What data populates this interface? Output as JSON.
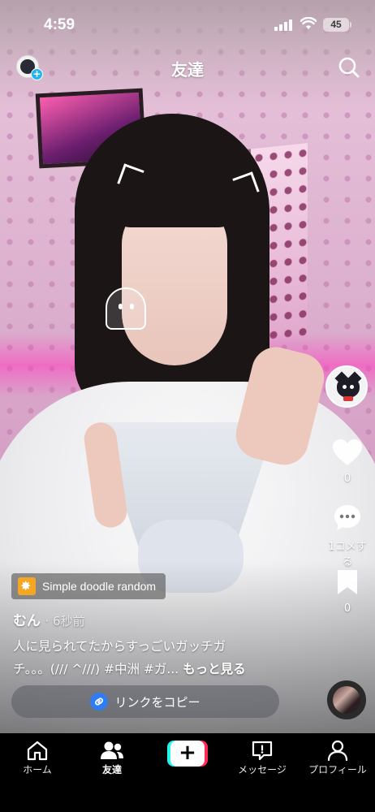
{
  "status_bar": {
    "time": "4:59",
    "battery": "45"
  },
  "header": {
    "title": "友達"
  },
  "rail": {
    "like_count": "0",
    "comment_label": "1コメする",
    "bookmark_count": "0"
  },
  "video": {
    "effect_label": "Simple doodle random",
    "author": "むん",
    "posted": "· 6秒前",
    "caption_line1": "人に見られてたからすっごいガッチガ",
    "caption_line2": "チ。。。(/// ^///) #中洲 #ガ...",
    "see_more": "もっと見る",
    "copy_link_label": "リンクをコピー"
  },
  "tabs": {
    "home": "ホーム",
    "friends": "友達",
    "inbox": "メッセージ",
    "profile": "プロフィール"
  },
  "icons": [
    "add-friend-icon",
    "search-icon",
    "heart-icon",
    "comment-icon",
    "bookmark-icon",
    "more-icon",
    "link-icon",
    "home-icon",
    "friends-icon",
    "plus-icon",
    "message-icon",
    "profile-icon"
  ],
  "colors": {
    "accent_cyan": "#25f4ee",
    "accent_red": "#fe2c55",
    "link_blue": "#2f7cf6",
    "effect_orange": "#f5a623"
  }
}
